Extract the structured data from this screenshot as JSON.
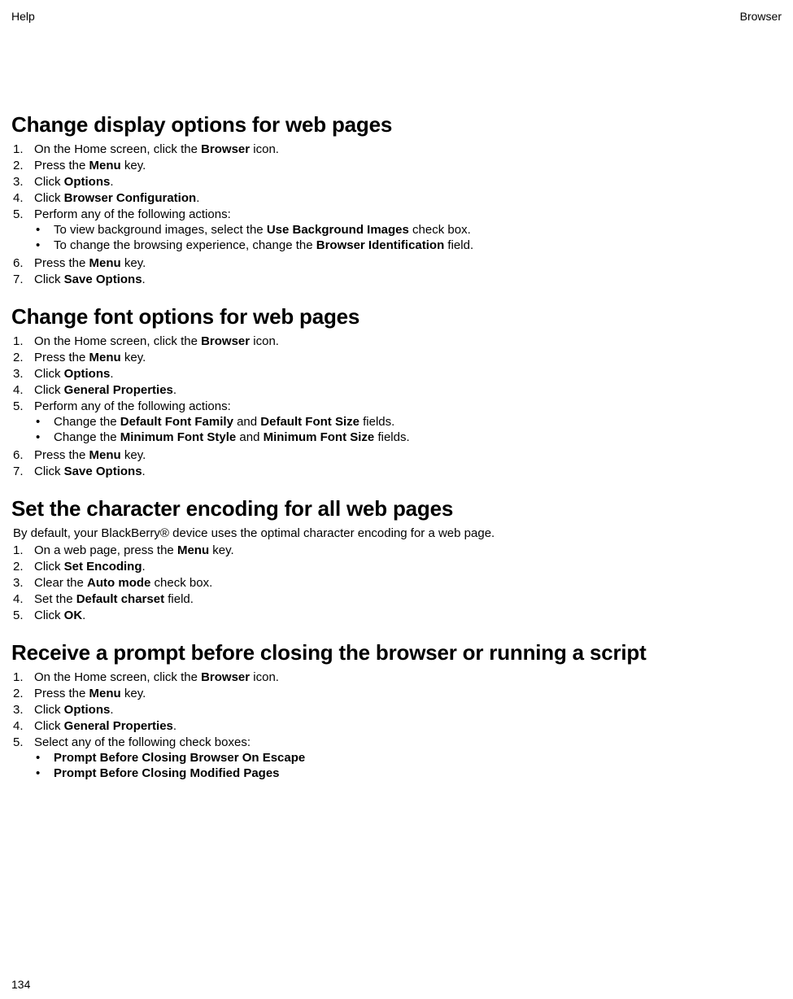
{
  "header": {
    "left": "Help",
    "right": "Browser"
  },
  "footer": {
    "page_number": "134"
  },
  "sections": [
    {
      "title": "Change display options for web pages",
      "intro": "",
      "steps": [
        {
          "num": "1.",
          "parts": [
            [
              "On the Home screen, click the ",
              false
            ],
            [
              "Browser",
              true
            ],
            [
              " icon.",
              false
            ]
          ]
        },
        {
          "num": "2.",
          "parts": [
            [
              "Press the ",
              false
            ],
            [
              "Menu",
              true
            ],
            [
              " key.",
              false
            ]
          ]
        },
        {
          "num": "3.",
          "parts": [
            [
              "Click ",
              false
            ],
            [
              "Options",
              true
            ],
            [
              ".",
              false
            ]
          ]
        },
        {
          "num": "4.",
          "parts": [
            [
              "Click ",
              false
            ],
            [
              "Browser Configuration",
              true
            ],
            [
              ".",
              false
            ]
          ]
        },
        {
          "num": "5.",
          "parts": [
            [
              "Perform any of the following actions:",
              false
            ]
          ],
          "bullets": [
            {
              "parts": [
                [
                  "To view background images, select the ",
                  false
                ],
                [
                  "Use Background Images",
                  true
                ],
                [
                  " check box.",
                  false
                ]
              ]
            },
            {
              "parts": [
                [
                  "To change the browsing experience, change the ",
                  false
                ],
                [
                  "Browser Identification",
                  true
                ],
                [
                  " field.",
                  false
                ]
              ]
            }
          ]
        },
        {
          "num": "6.",
          "parts": [
            [
              "Press the ",
              false
            ],
            [
              "Menu",
              true
            ],
            [
              " key.",
              false
            ]
          ]
        },
        {
          "num": "7.",
          "parts": [
            [
              "Click ",
              false
            ],
            [
              "Save Options",
              true
            ],
            [
              ".",
              false
            ]
          ]
        }
      ]
    },
    {
      "title": "Change font options for web pages",
      "intro": "",
      "steps": [
        {
          "num": "1.",
          "parts": [
            [
              "On the Home screen, click the ",
              false
            ],
            [
              "Browser",
              true
            ],
            [
              " icon.",
              false
            ]
          ]
        },
        {
          "num": "2.",
          "parts": [
            [
              "Press the ",
              false
            ],
            [
              "Menu",
              true
            ],
            [
              " key.",
              false
            ]
          ]
        },
        {
          "num": "3.",
          "parts": [
            [
              "Click ",
              false
            ],
            [
              "Options",
              true
            ],
            [
              ".",
              false
            ]
          ]
        },
        {
          "num": "4.",
          "parts": [
            [
              "Click ",
              false
            ],
            [
              "General Properties",
              true
            ],
            [
              ".",
              false
            ]
          ]
        },
        {
          "num": "5.",
          "parts": [
            [
              "Perform any of the following actions:",
              false
            ]
          ],
          "bullets": [
            {
              "parts": [
                [
                  "Change the ",
                  false
                ],
                [
                  "Default Font Family",
                  true
                ],
                [
                  " and ",
                  false
                ],
                [
                  "Default Font Size",
                  true
                ],
                [
                  " fields.",
                  false
                ]
              ]
            },
            {
              "parts": [
                [
                  "Change the ",
                  false
                ],
                [
                  "Minimum Font Style",
                  true
                ],
                [
                  " and ",
                  false
                ],
                [
                  "Minimum Font Size",
                  true
                ],
                [
                  " fields.",
                  false
                ]
              ]
            }
          ]
        },
        {
          "num": "6.",
          "parts": [
            [
              "Press the ",
              false
            ],
            [
              "Menu",
              true
            ],
            [
              " key.",
              false
            ]
          ]
        },
        {
          "num": "7.",
          "parts": [
            [
              "Click ",
              false
            ],
            [
              "Save Options",
              true
            ],
            [
              ".",
              false
            ]
          ]
        }
      ]
    },
    {
      "title": "Set the character encoding for all web pages",
      "intro": "By default, your BlackBerry® device uses the optimal character encoding for a web page.",
      "steps": [
        {
          "num": "1.",
          "parts": [
            [
              "On a web page, press the ",
              false
            ],
            [
              "Menu",
              true
            ],
            [
              " key.",
              false
            ]
          ]
        },
        {
          "num": "2.",
          "parts": [
            [
              "Click ",
              false
            ],
            [
              "Set Encoding",
              true
            ],
            [
              ".",
              false
            ]
          ]
        },
        {
          "num": "3.",
          "parts": [
            [
              "Clear the ",
              false
            ],
            [
              "Auto mode",
              true
            ],
            [
              " check box.",
              false
            ]
          ]
        },
        {
          "num": "4.",
          "parts": [
            [
              "Set the ",
              false
            ],
            [
              "Default charset",
              true
            ],
            [
              " field.",
              false
            ]
          ]
        },
        {
          "num": "5.",
          "parts": [
            [
              "Click ",
              false
            ],
            [
              "OK",
              true
            ],
            [
              ".",
              false
            ]
          ]
        }
      ]
    },
    {
      "title": "Receive a prompt before closing the browser or running a script",
      "intro": "",
      "steps": [
        {
          "num": "1.",
          "parts": [
            [
              "On the Home screen, click the ",
              false
            ],
            [
              "Browser",
              true
            ],
            [
              " icon.",
              false
            ]
          ]
        },
        {
          "num": "2.",
          "parts": [
            [
              "Press the ",
              false
            ],
            [
              "Menu",
              true
            ],
            [
              " key.",
              false
            ]
          ]
        },
        {
          "num": "3.",
          "parts": [
            [
              "Click ",
              false
            ],
            [
              "Options",
              true
            ],
            [
              ".",
              false
            ]
          ]
        },
        {
          "num": "4.",
          "parts": [
            [
              "Click ",
              false
            ],
            [
              "General Properties",
              true
            ],
            [
              ".",
              false
            ]
          ]
        },
        {
          "num": "5.",
          "parts": [
            [
              "Select any of the following check boxes:",
              false
            ]
          ],
          "bullets": [
            {
              "parts": [
                [
                  "Prompt Before Closing Browser On Escape",
                  true
                ]
              ]
            },
            {
              "parts": [
                [
                  "Prompt Before Closing Modified Pages",
                  true
                ]
              ]
            }
          ]
        }
      ]
    }
  ]
}
